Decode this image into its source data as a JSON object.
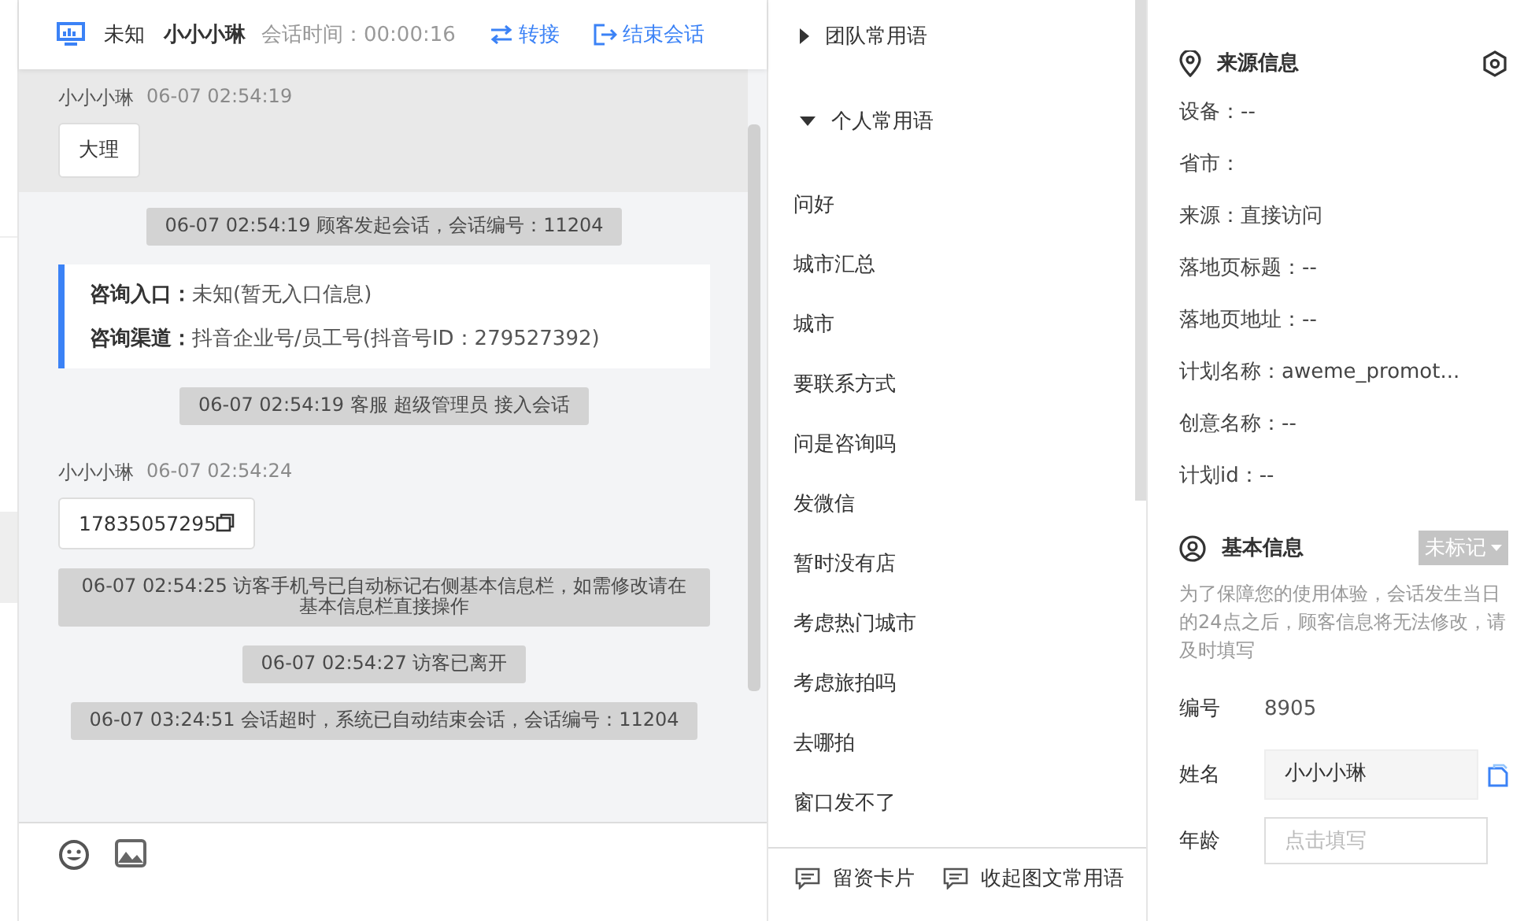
{
  "header": {
    "device_label": "未知",
    "visitor": "小小小琳",
    "timer_label": "会话时间：",
    "timer": "00:00:16",
    "actions": [
      {
        "label": "转接",
        "kind": "transfer"
      },
      {
        "label": "结束会话",
        "kind": "end"
      }
    ]
  },
  "messages": [
    {
      "kind": "visitor",
      "sender": "小小小琳",
      "time": "06-07 02:54:19",
      "text": "大理",
      "highlighted": true,
      "copyable": false
    },
    {
      "kind": "system",
      "text": "06-07 02:54:19 顾客发起会话，会话编号：11204"
    },
    {
      "kind": "info",
      "lines": [
        {
          "label": "咨询入口：",
          "value": "未知(暂无入口信息)"
        },
        {
          "label": "咨询渠道：",
          "value": "抖音企业号/员工号(抖音号ID：279527392)"
        }
      ]
    },
    {
      "kind": "system",
      "text": "06-07 02:54:19 客服 超级管理员 接入会话"
    },
    {
      "kind": "visitor",
      "sender": "小小小琳",
      "time": "06-07 02:54:24",
      "text": "17835057295",
      "highlighted": false,
      "copyable": true
    },
    {
      "kind": "system",
      "text": "06-07 02:54:25 访客手机号已自动标记右侧基本信息栏，如需修改请在基本信息栏直接操作"
    },
    {
      "kind": "system",
      "text": "06-07 02:54:27 访客已离开"
    },
    {
      "kind": "system",
      "text": "06-07 03:24:51 会话超时，系统已自动结束会话，会话编号：11204"
    }
  ],
  "composer_actions": [
    {
      "label": "留资卡片"
    },
    {
      "label": "收起图文常用语"
    }
  ],
  "phrase_groups": [
    {
      "label": "团队常用语",
      "expanded": false
    },
    {
      "label": "个人常用语",
      "expanded": true,
      "items": [
        "问好",
        "城市汇总",
        "城市",
        "要联系方式",
        "问是咨询吗",
        "发微信",
        "暂时没有店",
        "考虑热门城市",
        "考虑旅拍吗",
        "去哪拍",
        "窗口发不了"
      ]
    }
  ],
  "source_info": {
    "title": "来源信息",
    "fields": [
      "设备：--",
      "省市：",
      "来源：直接访问",
      "落地页标题：--",
      "落地页地址：--",
      "计划名称：aweme_promot...",
      "创意名称：--",
      "计划id：--"
    ]
  },
  "basic_info": {
    "title": "基本信息",
    "tag": "未标记",
    "notice": "为了保障您的使用体验，会话发生当日的24点之后，顾客信息将无法修改，请及时填写",
    "fields": [
      {
        "kind": "text",
        "label": "编号",
        "value": "8905"
      },
      {
        "kind": "filled",
        "label": "姓名",
        "value": "小小小琳"
      },
      {
        "kind": "input",
        "label": "年龄",
        "placeholder": "点击填写"
      }
    ]
  }
}
